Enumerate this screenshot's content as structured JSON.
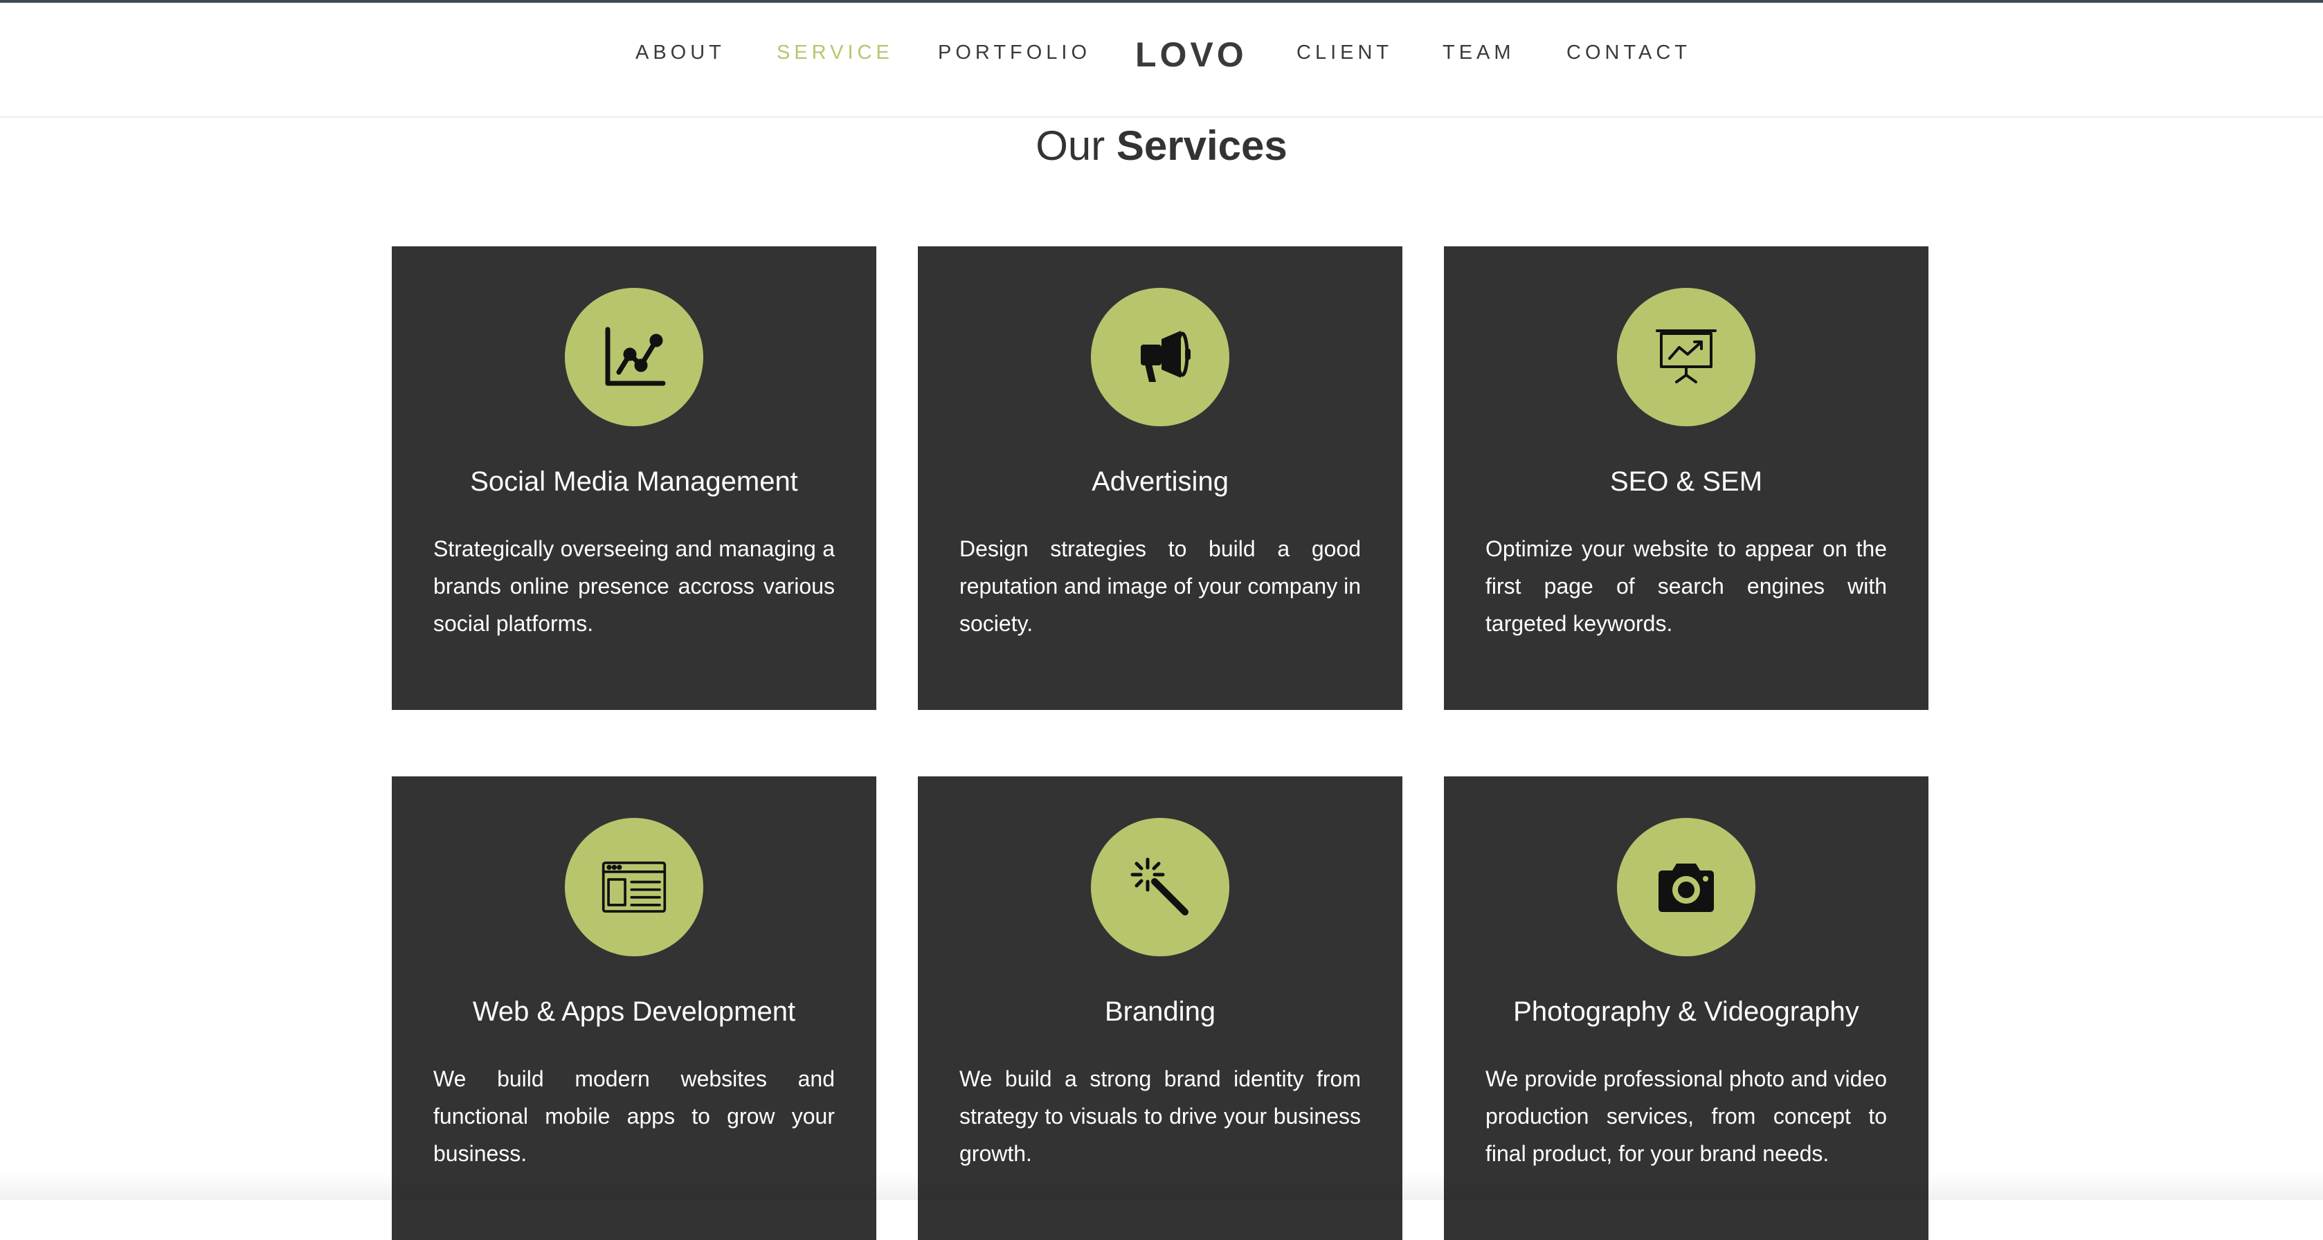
{
  "nav": {
    "items": [
      {
        "label": "ABOUT",
        "active": false
      },
      {
        "label": "SERVICE",
        "active": true
      },
      {
        "label": "PORTFOLIO",
        "active": false
      },
      {
        "label": "CLIENT",
        "active": false
      },
      {
        "label": "TEAM",
        "active": false
      },
      {
        "label": "CONTACT",
        "active": false
      }
    ],
    "logo": "LOVO"
  },
  "section": {
    "title_light": "Our ",
    "title_bold": "Services"
  },
  "services": [
    {
      "icon": "line-chart-icon",
      "title": "Social Media Management",
      "description": "Strategically overseeing and managing a brands online presence accross various social platforms."
    },
    {
      "icon": "megaphone-icon",
      "title": "Advertising",
      "description": "Design strategies to build a good reputation and image of your company in society."
    },
    {
      "icon": "presentation-board-icon",
      "title": "SEO & SEM",
      "description": "Optimize your website to appear on the first page of search engines with targeted keywords."
    },
    {
      "icon": "browser-window-icon",
      "title": "Web & Apps Development",
      "description": "We build modern websites and functional mobile apps to grow your business."
    },
    {
      "icon": "magic-wand-icon",
      "title": "Branding",
      "description": "We build a strong brand identity from strategy to visuals to drive your business growth."
    },
    {
      "icon": "camera-icon",
      "title": "Photography & Videography",
      "description": "We provide professional photo and video production services, from concept to final product, for your brand needs."
    }
  ],
  "colors": {
    "accent": "#b8c56d",
    "card_bg": "#333333",
    "text_dark": "#3a3a3a"
  }
}
